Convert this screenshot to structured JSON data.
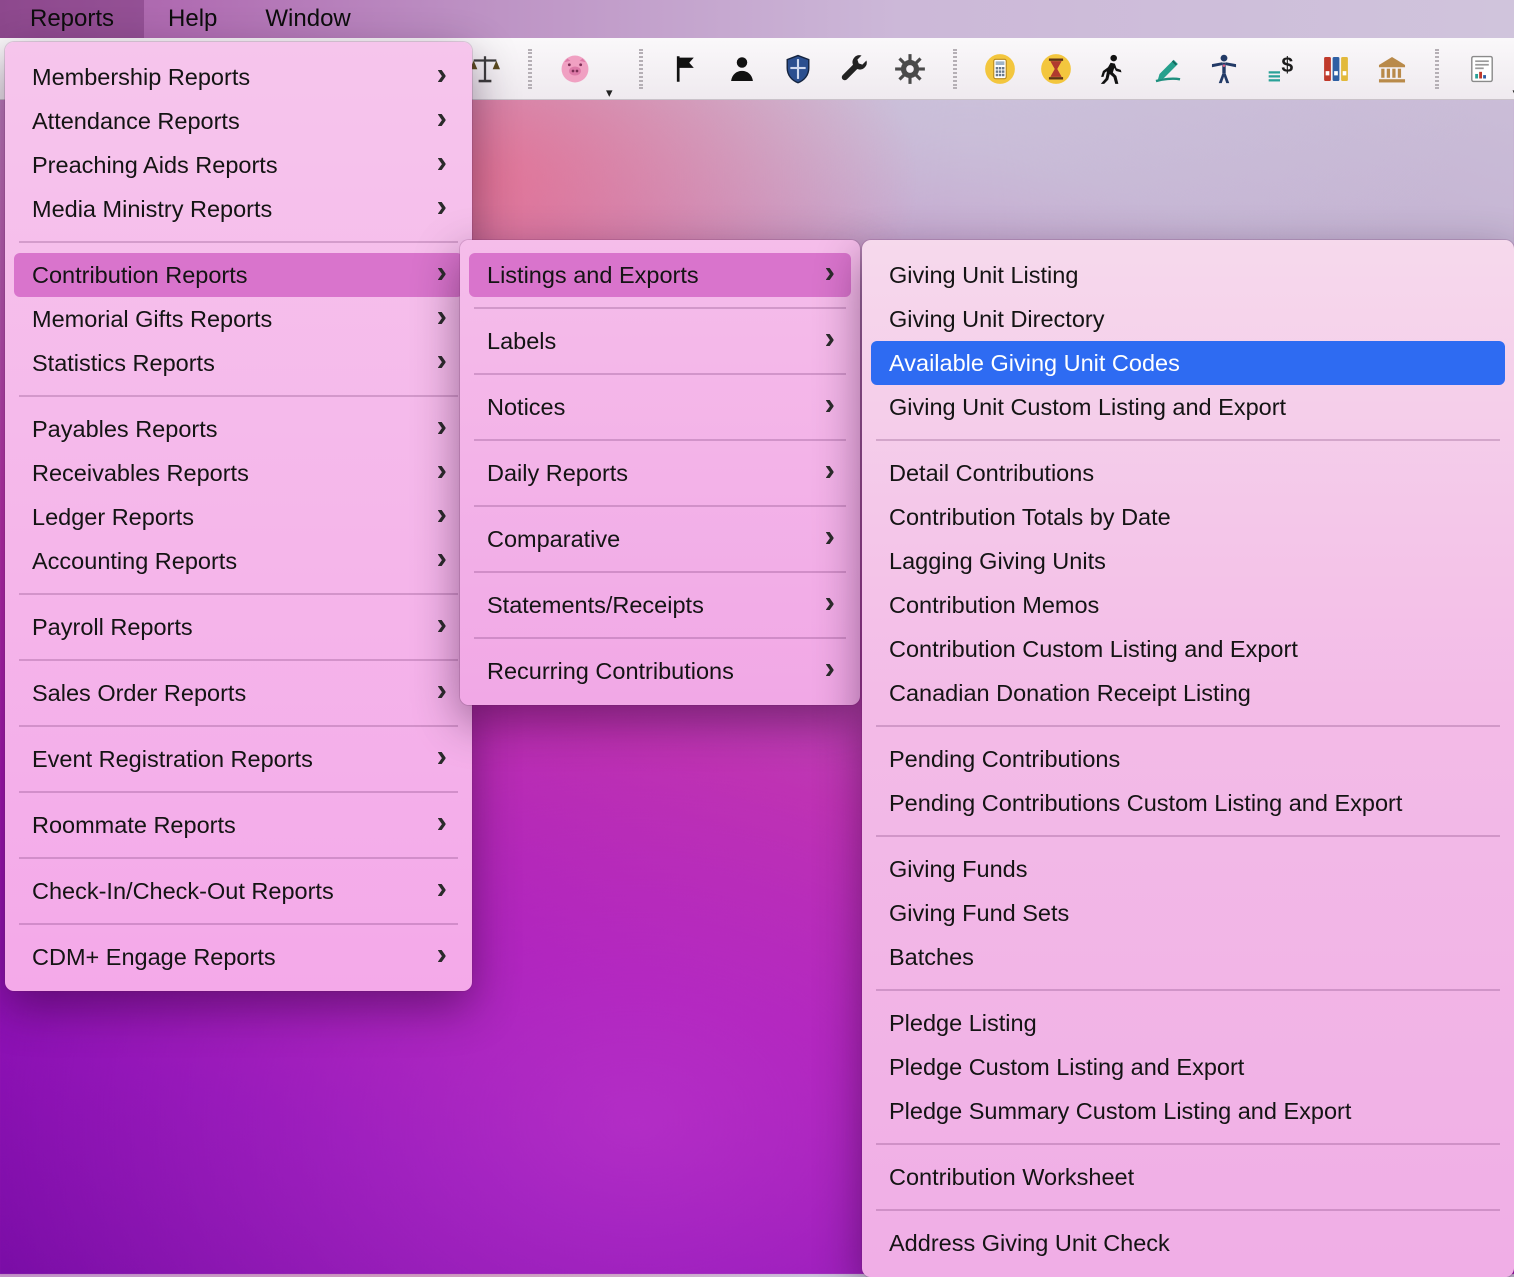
{
  "colors": {
    "selection_blue": "#2e6bf2",
    "menu_highlight_pink": "#d974cc",
    "menu_background_pink": "#f4b0e8",
    "menubar_purple": "#b06cb2"
  },
  "menubar": {
    "items": [
      {
        "label": "Reports",
        "active": true
      },
      {
        "label": "Help",
        "active": false
      },
      {
        "label": "Window",
        "active": false
      }
    ]
  },
  "toolbar": {
    "icons": [
      {
        "name": "scales-icon"
      },
      {
        "name": "piggy-bank-icon",
        "has_dropdown": true
      },
      {
        "name": "flag-icon"
      },
      {
        "name": "person-icon"
      },
      {
        "name": "shield-icon"
      },
      {
        "name": "wrench-icon"
      },
      {
        "name": "gear-icon"
      },
      {
        "name": "calculator-icon"
      },
      {
        "name": "hourglass-icon"
      },
      {
        "name": "walking-person-icon"
      },
      {
        "name": "signature-pen-icon"
      },
      {
        "name": "presenting-person-icon"
      },
      {
        "name": "dollar-sign-icon"
      },
      {
        "name": "binders-icon"
      },
      {
        "name": "bank-icon"
      },
      {
        "name": "report-document-icon",
        "has_dropdown": true
      }
    ]
  },
  "reports_menu": {
    "items": [
      {
        "label": "Membership Reports"
      },
      {
        "label": "Attendance Reports"
      },
      {
        "label": "Preaching Aids Reports"
      },
      {
        "label": "Media Ministry Reports"
      },
      {
        "label": "Contribution Reports",
        "state": "open"
      },
      {
        "label": "Memorial Gifts Reports"
      },
      {
        "label": "Statistics Reports"
      },
      {
        "label": "Payables Reports"
      },
      {
        "label": "Receivables Reports"
      },
      {
        "label": "Ledger Reports"
      },
      {
        "label": "Accounting Reports"
      },
      {
        "label": "Payroll Reports"
      },
      {
        "label": "Sales Order Reports"
      },
      {
        "label": "Event Registration Reports"
      },
      {
        "label": "Roommate Reports"
      },
      {
        "label": "Check-In/Check-Out Reports"
      },
      {
        "label": "CDM+ Engage Reports"
      }
    ]
  },
  "contrib_menu": {
    "items": [
      {
        "label": "Listings and Exports",
        "state": "open"
      },
      {
        "label": "Labels"
      },
      {
        "label": "Notices"
      },
      {
        "label": "Daily Reports"
      },
      {
        "label": "Comparative"
      },
      {
        "label": "Statements/Receipts"
      },
      {
        "label": "Recurring Contributions"
      }
    ]
  },
  "listings_menu": {
    "items": [
      {
        "label": "Giving Unit Listing"
      },
      {
        "label": "Giving Unit Directory"
      },
      {
        "label": "Available Giving Unit Codes",
        "state": "selected"
      },
      {
        "label": "Giving Unit Custom Listing and Export"
      },
      {
        "label": "Detail Contributions"
      },
      {
        "label": "Contribution Totals by Date"
      },
      {
        "label": "Lagging Giving Units"
      },
      {
        "label": "Contribution Memos"
      },
      {
        "label": "Contribution Custom Listing and Export"
      },
      {
        "label": "Canadian Donation Receipt Listing"
      },
      {
        "label": "Pending Contributions"
      },
      {
        "label": "Pending Contributions Custom Listing and Export"
      },
      {
        "label": "Giving Funds"
      },
      {
        "label": "Giving Fund Sets"
      },
      {
        "label": "Batches"
      },
      {
        "label": "Pledge Listing"
      },
      {
        "label": "Pledge Custom Listing and Export"
      },
      {
        "label": "Pledge Summary Custom Listing and Export"
      },
      {
        "label": "Contribution Worksheet"
      },
      {
        "label": "Address Giving Unit Check"
      }
    ]
  }
}
